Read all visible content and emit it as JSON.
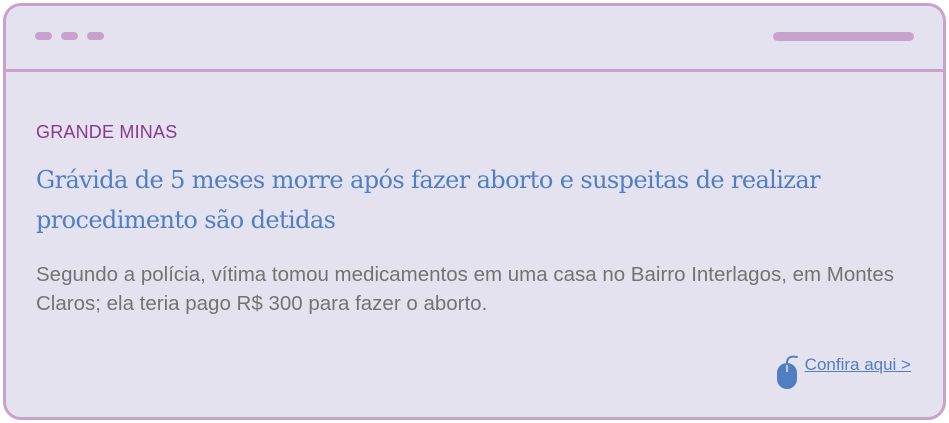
{
  "colors": {
    "frame_border": "#c8a2cc",
    "background": "#e5e2ef",
    "category": "#8a3a8a",
    "headline": "#4f7fc2",
    "summary": "#737373",
    "link": "#4f7fc2"
  },
  "article": {
    "category": "GRANDE MINAS",
    "headline": "Grávida de 5 meses morre após fazer aborto e suspeitas de realizar procedimento são detidas",
    "summary": "Segundo a polícia, vítima tomou medicamentos em uma casa no Bairro Interlagos, em Montes Claros; ela teria pago R$ 300 para fazer o aborto.",
    "cta_label": "Confira aqui >",
    "cta_icon": "mouse-icon"
  }
}
